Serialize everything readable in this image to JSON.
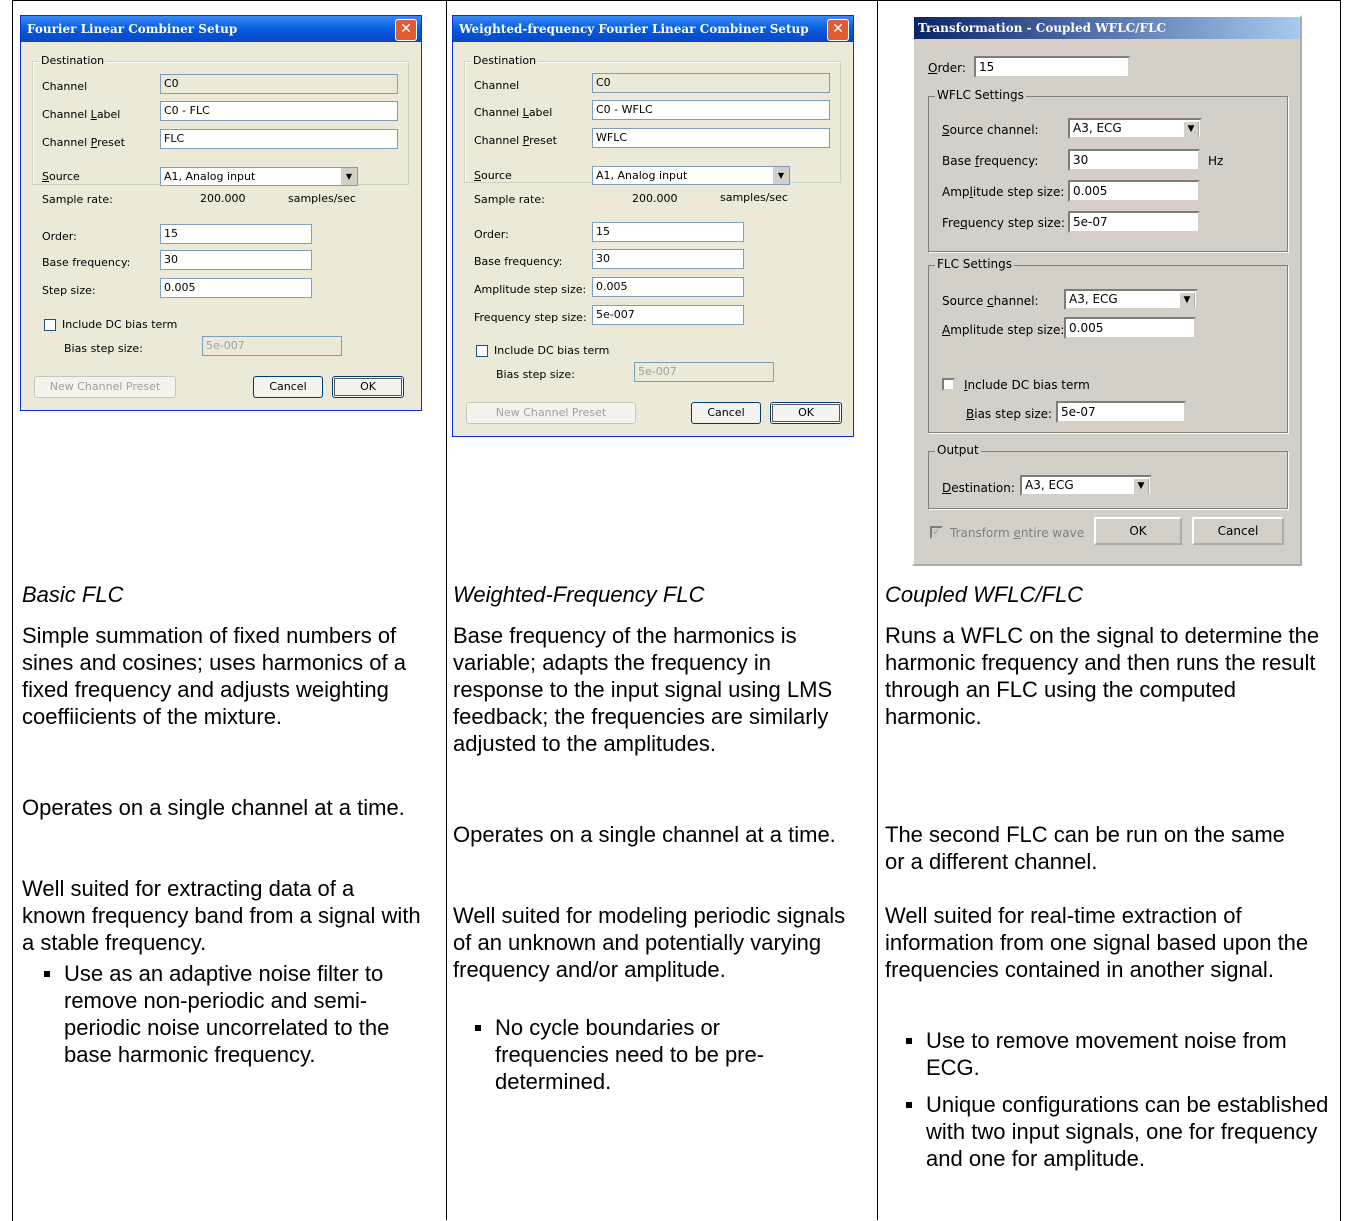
{
  "dialogs": {
    "flc": {
      "title": "Fourier Linear Combiner Setup",
      "destination_group": "Destination",
      "channel_label": "Channel",
      "channel_value": "C0",
      "channel_label_label": "Channel Label",
      "channel_label_value": "C0 - FLC",
      "channel_preset_label": "Channel Preset",
      "channel_preset_value": "FLC",
      "source_label": "Source",
      "source_value": "A1, Analog input",
      "sample_rate_label": "Sample rate:",
      "sample_rate_value": "200.000",
      "sample_rate_unit": "samples/sec",
      "order_label": "Order:",
      "order_value": "15",
      "base_freq_label": "Base frequency:",
      "base_freq_value": "30",
      "step_size_label": "Step size:",
      "step_size_value": "0.005",
      "include_dc_label": "Include DC bias term",
      "bias_step_label": "Bias step size:",
      "bias_step_value": "5e-007",
      "new_preset_button": "New Channel Preset",
      "cancel_button": "Cancel",
      "ok_button": "OK"
    },
    "wflc": {
      "title": "Weighted-frequency Fourier Linear Combiner Setup",
      "destination_group": "Destination",
      "channel_label": "Channel",
      "channel_value": "C0",
      "channel_label_label": "Channel Label",
      "channel_label_value": "C0 - WFLC",
      "channel_preset_label": "Channel Preset",
      "channel_preset_value": "WFLC",
      "source_label": "Source",
      "source_value": "A1, Analog input",
      "sample_rate_label": "Sample rate:",
      "sample_rate_value": "200.000",
      "sample_rate_unit": "samples/sec",
      "order_label": "Order:",
      "order_value": "15",
      "base_freq_label": "Base frequency:",
      "base_freq_value": "30",
      "amp_step_label": "Amplitude step size:",
      "amp_step_value": "0.005",
      "freq_step_label": "Frequency step size:",
      "freq_step_value": "5e-007",
      "include_dc_label": "Include DC bias term",
      "bias_step_label": "Bias step size:",
      "bias_step_value": "5e-007",
      "new_preset_button": "New Channel Preset",
      "cancel_button": "Cancel",
      "ok_button": "OK"
    },
    "coupled": {
      "title": "Transformation - Coupled WFLC/FLC",
      "order_label": "Order:",
      "order_value": "15",
      "wflc_group": "WFLC Settings",
      "wflc_source_label": "Source channel:",
      "wflc_source_value": "A3, ECG",
      "wflc_base_freq_label": "Base frequency:",
      "wflc_base_freq_value": "30",
      "wflc_base_freq_unit": "Hz",
      "wflc_amp_step_label": "Amplitude step size:",
      "wflc_amp_step_value": "0.005",
      "wflc_freq_step_label": "Frequency step size:",
      "wflc_freq_step_value": "5e-07",
      "flc_group": "FLC Settings",
      "flc_source_label": "Source channel:",
      "flc_source_value": "A3, ECG",
      "flc_amp_step_label": "Amplitude step size:",
      "flc_amp_step_value": "0.005",
      "include_dc_label": "Include DC bias term",
      "bias_step_label": "Bias step size:",
      "bias_step_value": "5e-07",
      "output_group": "Output",
      "destination_label": "Destination:",
      "destination_value": "A3, ECG",
      "transform_entire_label": "Transform entire wave",
      "ok_button": "OK",
      "cancel_button": "Cancel"
    }
  },
  "columns": [
    {
      "caption": "Basic FLC",
      "description": "Simple summation of fixed numbers of sines and cosines; uses harmonics of a fixed frequency and adjusts weighting coeffiicients of the mixture.",
      "operates": "Operates on a single channel at a time.",
      "suited": "Well suited for extracting data of a known frequency band from a signal with a stable frequency.",
      "bullets": [
        "Use as an adaptive noise filter to remove non-periodic and semi-periodic noise uncorrelated to the base harmonic frequency."
      ]
    },
    {
      "caption": "Weighted-Frequency FLC",
      "description": "Base frequency of the harmonics is variable; adapts the frequency in response to the input signal using LMS feedback; the frequencies are similarly adjusted to the amplitudes.",
      "operates": "Operates on a single channel at a time.",
      "suited": "Well suited for modeling periodic signals of an unknown and potentially varying frequency and/or amplitude.",
      "bullets": [
        "No cycle boundaries or frequencies need to be pre-determined."
      ]
    },
    {
      "caption": "Coupled WFLC/FLC",
      "description": "Runs a WFLC on the signal to determine the harmonic frequency and then runs the result through an FLC using the computed harmonic.",
      "operates": "The second FLC can be run on the same or a different channel.",
      "suited": "Well suited for real-time extraction of information from one signal based upon the frequencies contained in another signal.",
      "bullets": [
        "Use to remove movement noise from ECG.",
        "Unique configurations can be established with two input signals, one for frequency and one for amplitude."
      ]
    }
  ]
}
